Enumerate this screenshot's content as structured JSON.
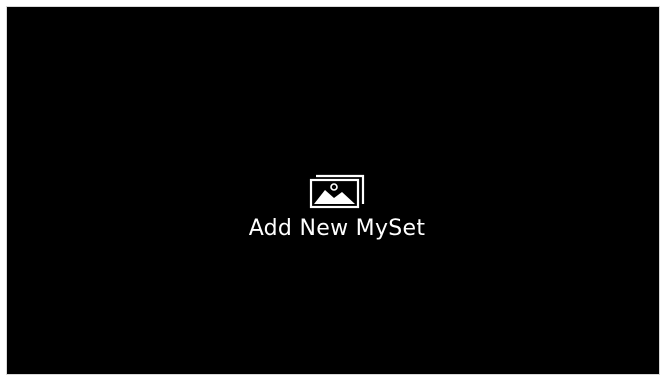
{
  "screen": {
    "background": "#000000",
    "add_button": {
      "icon": "photo-stack-icon",
      "label": "Add New MySet"
    }
  }
}
